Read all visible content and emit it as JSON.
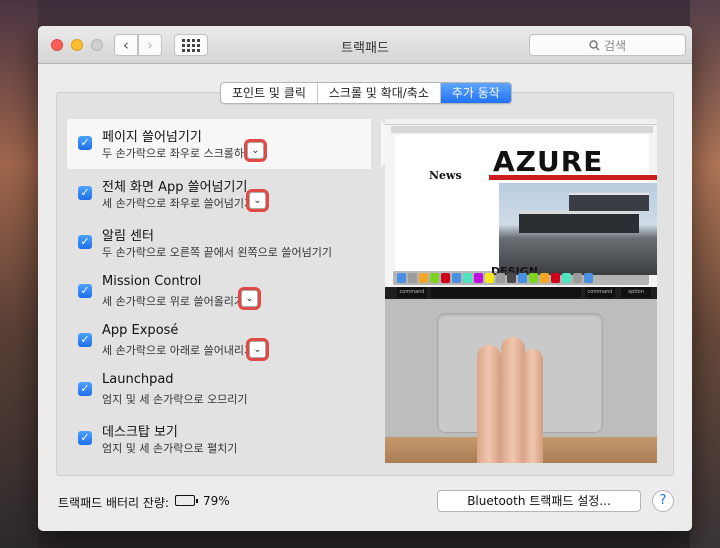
{
  "window": {
    "title": "트랙패드",
    "search_placeholder": "검색"
  },
  "tabs": [
    {
      "label": "포인트 및 클릭",
      "active": false
    },
    {
      "label": "스크롤 및 확대/축소",
      "active": false
    },
    {
      "label": "추가 동작",
      "active": true
    }
  ],
  "gestures": [
    {
      "title": "페이지 쓸어넘기기",
      "description": "두 손가락으로 좌우로 스크롤하기",
      "checked": true,
      "has_dropdown": true
    },
    {
      "title": "전체 화면 App 쓸어넘기기",
      "description": "세 손가락으로 좌우로 쓸어넘기기",
      "checked": true,
      "has_dropdown": true
    },
    {
      "title": "알림 센터",
      "description": "두 손가락으로 오른쪽 끝에서 왼쪽으로 쓸어넘기기",
      "checked": true,
      "has_dropdown": false
    },
    {
      "title": "Mission Control",
      "description": "세 손가락으로 위로 쓸어올리기",
      "checked": true,
      "has_dropdown": true
    },
    {
      "title": "App Exposé",
      "description": "세 손가락으로 아래로 쓸어내리기",
      "checked": true,
      "has_dropdown": true
    },
    {
      "title": "Launchpad",
      "description": "엄지 및 세 손가락으로 오므리기",
      "checked": true,
      "has_dropdown": false
    },
    {
      "title": "데스크탑 보기",
      "description": "엄지 및 세 손가락으로 펼치기",
      "checked": true,
      "has_dropdown": false
    }
  ],
  "preview": {
    "headline": "AZURE",
    "news_label": "News",
    "design_label": "DESIGN",
    "key_left": "command",
    "key_right": "command",
    "key_option": "option"
  },
  "footer": {
    "battery_label": "트랙패드 배터리 잔량:",
    "battery_percent": "79%",
    "battery_level": 0.79,
    "bluetooth_button": "Bluetooth 트랙패드 설정...",
    "help_label": "?"
  },
  "colors": {
    "accent": "#2173f3",
    "highlight_outline": "#e04a45"
  }
}
